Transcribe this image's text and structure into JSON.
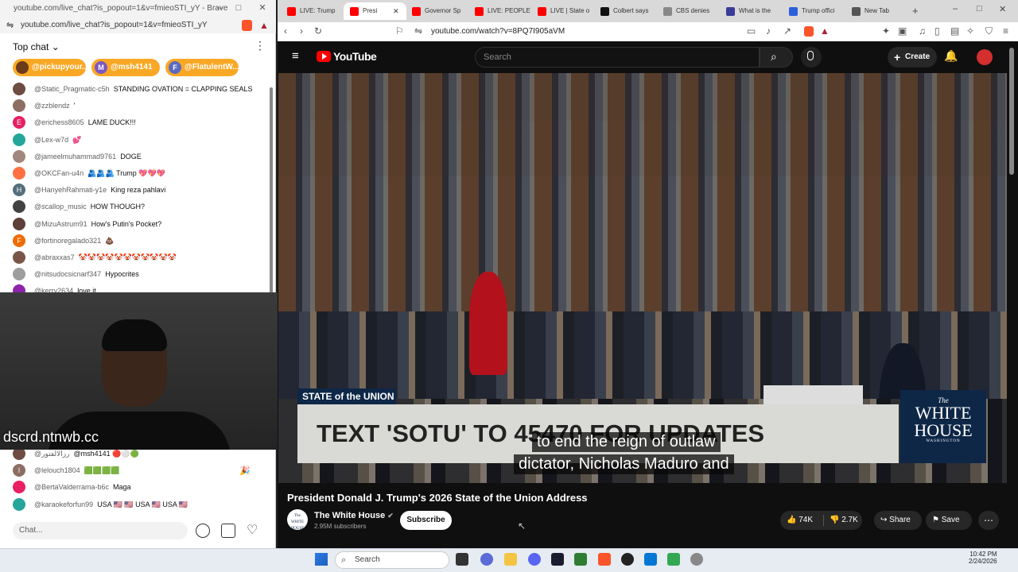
{
  "chat_window": {
    "title": "youtube.com/live_chat?is_popout=1&v=fmieoSTI_yY - Brave",
    "url": "youtube.com/live_chat?is_popout=1&v=fmieoSTI_yY",
    "header": "Top chat",
    "pinned": [
      "@pickupyour...",
      "@msh4141",
      "@FlatulentW..."
    ],
    "pinned_initials": [
      "",
      "M",
      "F"
    ],
    "messages": [
      {
        "author": "@Static_Pragmatic-c5h",
        "text": "STANDING OVATION = CLAPPING SEALS"
      },
      {
        "author": "@zzblendz",
        "text": "'"
      },
      {
        "author": "@erichess8605",
        "text": "LAME DUCK!!!"
      },
      {
        "author": "@Lex-w7d",
        "text": "💕"
      },
      {
        "author": "@jameelmuhammad9761",
        "text": "DOGE"
      },
      {
        "author": "@OKCFan-u4n",
        "text": "🫂🫂🫂 Trump 💖💖💖"
      },
      {
        "author": "@HanyehRahmati-y1e",
        "text": "King reza pahlavi"
      },
      {
        "author": "@scallop_music",
        "text": "HOW THOUGH?"
      },
      {
        "author": "@MizuAstrum91",
        "text": "How's Putin's Pocket?"
      },
      {
        "author": "@fortinoregalado321",
        "text": "💩"
      },
      {
        "author": "@abraxxas7",
        "text": "🤡🤡🤡🤡🤡🤡🤡🤡🤡🤡🤡"
      },
      {
        "author": "@nitsudocsicnarf347",
        "text": "Hypocrites"
      },
      {
        "author": "@kerry2634",
        "text": "love it"
      }
    ],
    "messages_lower": [
      {
        "author": "@رزالالفتور",
        "text": "@msh4141 🔴⚪🟢"
      },
      {
        "author": "@lelouch1804",
        "text": "🟩🟩🟩🟩"
      },
      {
        "author": "@BertaValderrama-b6c",
        "text": "Maga"
      },
      {
        "author": "@karaokeforfun99",
        "text": "USA 🇺🇸 🇺🇸 USA 🇺🇸 USA 🇺🇸"
      }
    ],
    "lower_initials": [
      "",
      "l",
      "",
      ""
    ],
    "initials": [
      "",
      "",
      "E",
      "",
      "",
      "",
      "H",
      "",
      "",
      "F",
      "",
      "",
      ""
    ],
    "input_placeholder": "Chat...",
    "webcam_caption": "dscrd.ntnwb.cc"
  },
  "browser": {
    "tabs": [
      "LIVE: Trump",
      "Presi",
      "Governor Sp",
      "LIVE: PEOPLE",
      "LIVE | State o",
      "Colbert says",
      "CBS denies",
      "What is the",
      "Trump offici",
      "New Tab"
    ],
    "url": "youtube.com/watch?v=8PQ7I905aVM"
  },
  "youtube": {
    "logo_text": "YouTube",
    "search_placeholder": "Search",
    "create_label": "Create",
    "video": {
      "lowerthird_tag": "STATE of the UNION",
      "lowerthird_text": "TEXT 'SOTU' TO 45470 FOR UPDATES",
      "logo_small": "The",
      "logo_big_1": "WHITE",
      "logo_big_2": "HOUSE",
      "logo_tiny": "WASHINGTON",
      "caption_line1": "to end the reign of outlaw",
      "caption_line2": "dictator, Nicholas Maduro and"
    },
    "title": "President Donald J. Trump's 2026 State of the Union Address",
    "channel": "The White House",
    "subscribers": "2.95M subscribers",
    "subscribe_label": "Subscribe",
    "likes": "74K",
    "dislikes": "2.7K",
    "share_label": "Share",
    "save_label": "Save"
  },
  "taskbar": {
    "search_label": "Search",
    "time": "10:42 PM",
    "date": "2/24/2026"
  },
  "colors": {
    "pill": "#f9a825",
    "youtube_red": "#ff0000",
    "navy": "#0e2747"
  }
}
